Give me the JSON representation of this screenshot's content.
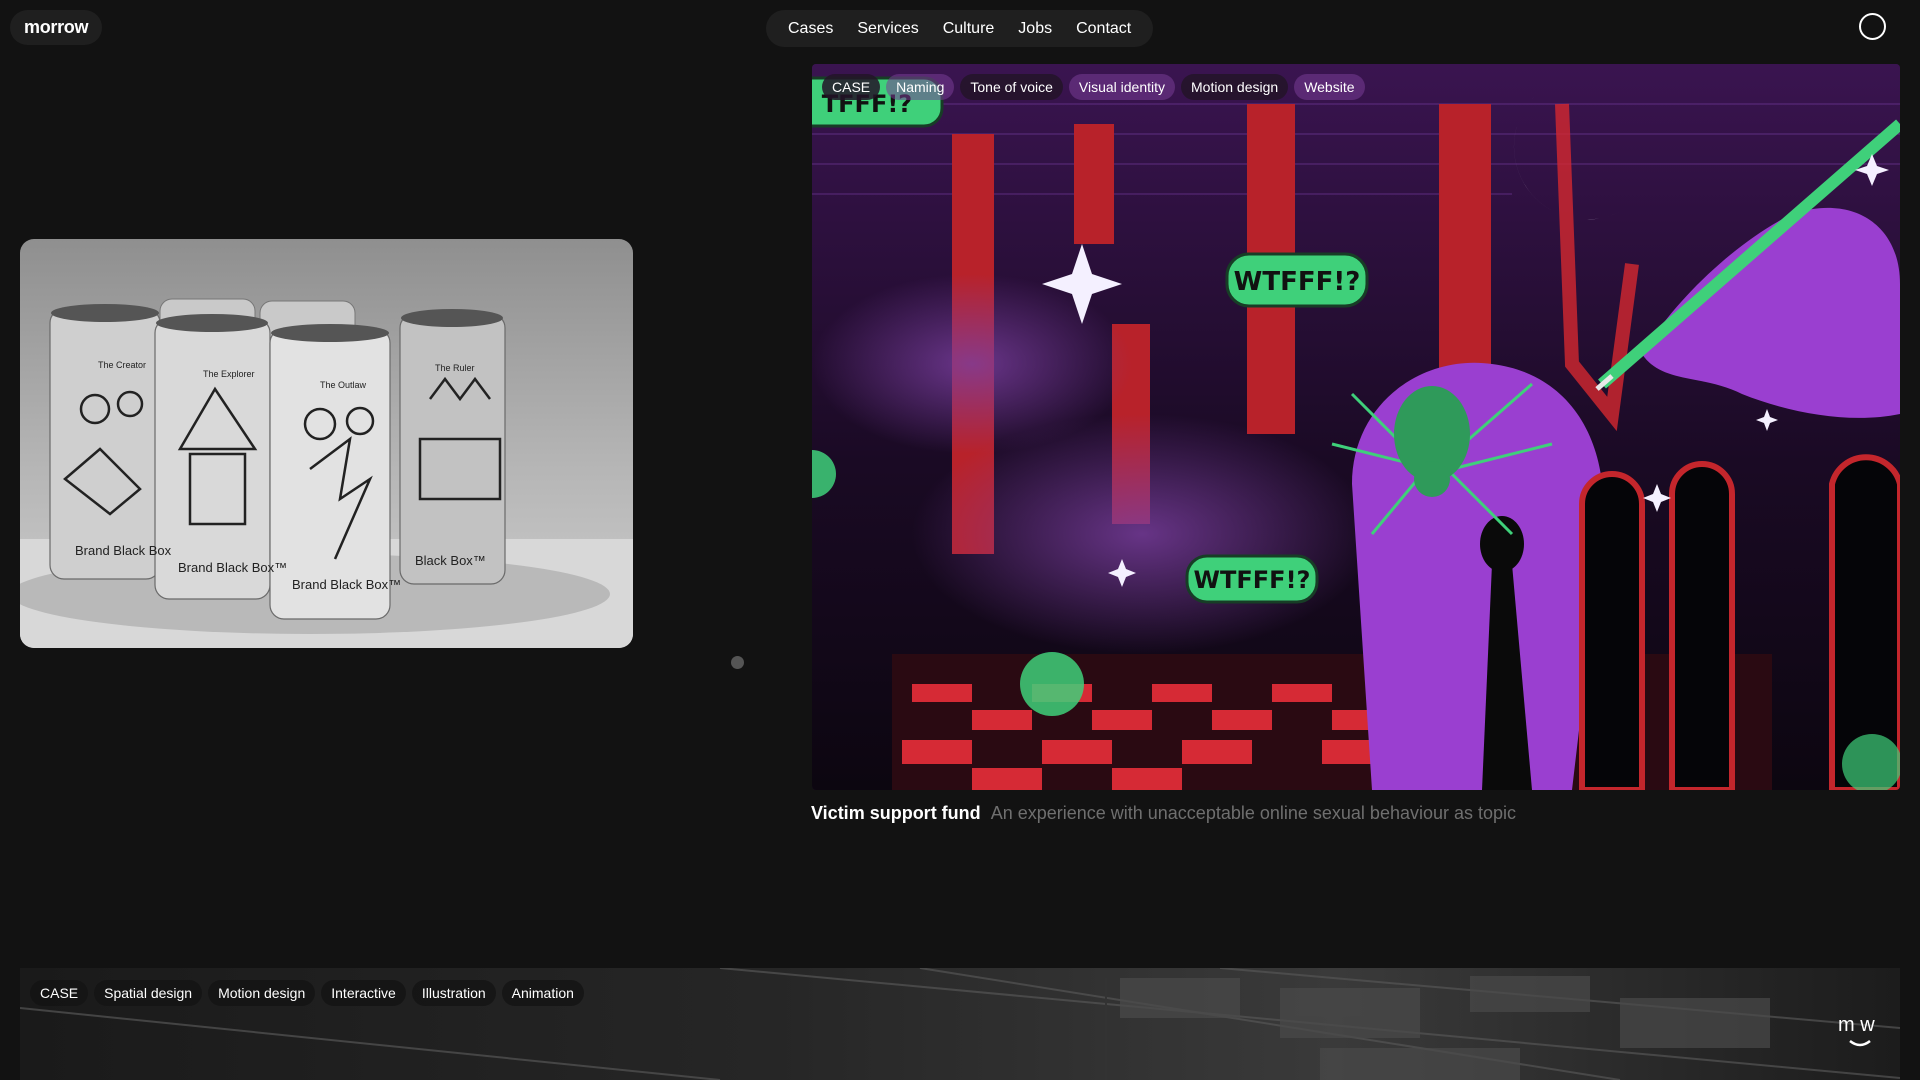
{
  "brand": {
    "logo": "morrow"
  },
  "nav": {
    "items": [
      "Cases",
      "Services",
      "Culture",
      "Jobs",
      "Contact"
    ]
  },
  "featured_case": {
    "tags": [
      "CASE",
      "Naming",
      "Tone of voice",
      "Visual identity",
      "Motion design",
      "Website"
    ],
    "title": "Victim support fund",
    "description": "An experience with unacceptable online sexual behaviour as topic",
    "speech_bubbles": [
      "WTFFF!?",
      "WTFFF!?",
      "TFFF!?"
    ]
  },
  "cans_image": {
    "labels": [
      "The Creator",
      "The Explorer",
      "The Outlaw",
      "The Ruler"
    ],
    "brand_text": [
      "Brand Black Box",
      "Brand Black Box™",
      "Brand Black Box™",
      "Black Box™"
    ]
  },
  "bottom_case": {
    "tags": [
      "CASE",
      "Spatial design",
      "Motion design",
      "Interactive",
      "Illustration",
      "Animation"
    ],
    "badge": "m w"
  },
  "colors": {
    "background": "#121212",
    "pill": "#1f1f1f",
    "caption_muted": "#6f6f6f",
    "art_purple": "#9a3fd0",
    "art_red": "#c4262c",
    "art_green": "#3fd07a"
  },
  "icons": {
    "theme_toggle": "circle-outline-icon",
    "badge": "mw-smile-icon"
  }
}
